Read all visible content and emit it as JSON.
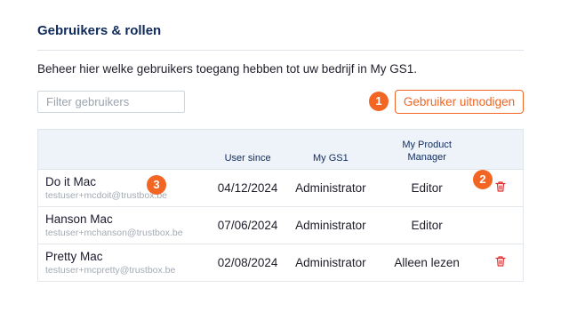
{
  "header": {
    "title": "Gebruikers & rollen"
  },
  "description": "Beheer hier welke gebruikers toegang hebben tot uw bedrijf in My GS1.",
  "filter": {
    "placeholder": "Filter gebruikers",
    "value": ""
  },
  "invite_button": "Gebruiker uitnodigen",
  "callouts": {
    "one": "1",
    "two": "2",
    "three": "3"
  },
  "table": {
    "columns": {
      "user_since": "User since",
      "my_gs1": "My GS1",
      "my_product_manager": "My Product Manager"
    },
    "rows": [
      {
        "name": "Do it Mac",
        "email": "testuser+mcdoit@trustbox.be",
        "since": "04/12/2024",
        "gs1_role": "Administrator",
        "pm_role": "Editor",
        "deletable": true
      },
      {
        "name": "Hanson Mac",
        "email": "testuser+mchanson@trustbox.be",
        "since": "07/06/2024",
        "gs1_role": "Administrator",
        "pm_role": "Editor",
        "deletable": false
      },
      {
        "name": "Pretty Mac",
        "email": "testuser+mcpretty@trustbox.be",
        "since": "02/08/2024",
        "gs1_role": "Administrator",
        "pm_role": "Alleen lezen",
        "deletable": true
      }
    ]
  },
  "colors": {
    "accent": "#f26522",
    "heading": "#0f2a5c",
    "table_header_bg": "#eef3fa",
    "delete_icon": "#e03131"
  },
  "icons": {
    "delete": "trash-icon"
  }
}
